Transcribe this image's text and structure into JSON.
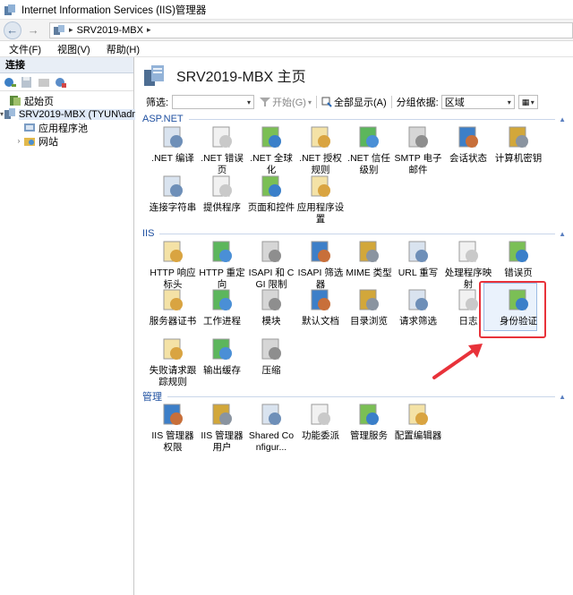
{
  "window": {
    "title": "Internet Information Services (IIS)管理器"
  },
  "address": {
    "path": "SRV2019-MBX",
    "arrow_glyph": "▸"
  },
  "menu": {
    "items": [
      "文件(F)",
      "视图(V)",
      "帮助(H)"
    ]
  },
  "connections": {
    "header": "连接",
    "tree": [
      {
        "label": "起始页",
        "level": 0
      },
      {
        "label": "SRV2019-MBX (TYUN\\adm",
        "level": 0,
        "expanded": true
      },
      {
        "label": "应用程序池",
        "level": 1
      },
      {
        "label": "网站",
        "level": 1
      }
    ]
  },
  "main": {
    "title": "SRV2019-MBX 主页",
    "filter": {
      "label": "筛选:",
      "start_label": "开始(G)",
      "show_all_label": "全部显示(A)",
      "group_by_label": "分组依据:",
      "group_by_value": "区域"
    },
    "groups": [
      {
        "name": "ASP.NET",
        "items": [
          ".NET 编译",
          ".NET 错误页",
          ".NET 全球化",
          ".NET 授权规则",
          ".NET 信任级别",
          "SMTP 电子邮件",
          "会话状态",
          "计算机密钥",
          "连接字符串",
          "提供程序",
          "页面和控件",
          "应用程序设置"
        ]
      },
      {
        "name": "IIS",
        "items": [
          "HTTP 响应标头",
          "HTTP 重定向",
          "ISAPI 和 CGI 限制",
          "ISAPI 筛选器",
          "MIME 类型",
          "URL 重写",
          "处理程序映射",
          "错误页",
          "服务器证书",
          "工作进程",
          "模块",
          "默认文档",
          "目录浏览",
          "请求筛选",
          "日志",
          "身份验证",
          "失败请求跟踪规则",
          "输出缓存",
          "压缩"
        ]
      },
      {
        "name": "管理",
        "items": [
          "IIS 管理器权限",
          "IIS 管理器用户",
          "Shared Configur...",
          "功能委派",
          "管理服务",
          "配置编辑器"
        ]
      }
    ],
    "highlighted_item": "身份验证"
  },
  "colors": {
    "group_label": "#1e4fa0",
    "highlight": "#e8323a"
  }
}
